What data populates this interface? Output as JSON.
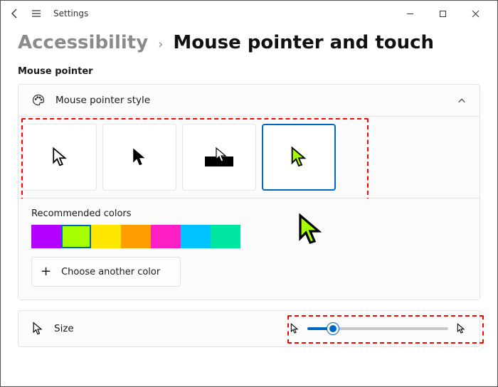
{
  "titlebar": {
    "title": "Settings"
  },
  "breadcrumb": {
    "parent": "Accessibility",
    "current": "Mouse pointer and touch"
  },
  "section": {
    "heading": "Mouse pointer"
  },
  "card": {
    "title": "Mouse pointer style",
    "expanded": true,
    "styles": [
      {
        "id": "white",
        "selected": false
      },
      {
        "id": "black",
        "selected": false
      },
      {
        "id": "inverted",
        "selected": false
      },
      {
        "id": "custom",
        "selected": true
      }
    ],
    "recommended_label": "Recommended colors",
    "colors": [
      {
        "name": "purple",
        "hex": "#b400ff",
        "selected": false
      },
      {
        "name": "lime",
        "hex": "#a6ff00",
        "selected": true
      },
      {
        "name": "yellow",
        "hex": "#ffe600",
        "selected": false
      },
      {
        "name": "orange",
        "hex": "#ff9e00",
        "selected": false
      },
      {
        "name": "magenta",
        "hex": "#ff1fc5",
        "selected": false
      },
      {
        "name": "cyan",
        "hex": "#00c3ff",
        "selected": false
      },
      {
        "name": "aqua",
        "hex": "#00e5a0",
        "selected": false
      }
    ],
    "choose_label": "Choose another color",
    "preview_color": "#a6ff00"
  },
  "size": {
    "label": "Size",
    "slider_percent": 18
  },
  "annotations": [
    {
      "id": "styles-highlight"
    },
    {
      "id": "slider-highlight"
    }
  ]
}
